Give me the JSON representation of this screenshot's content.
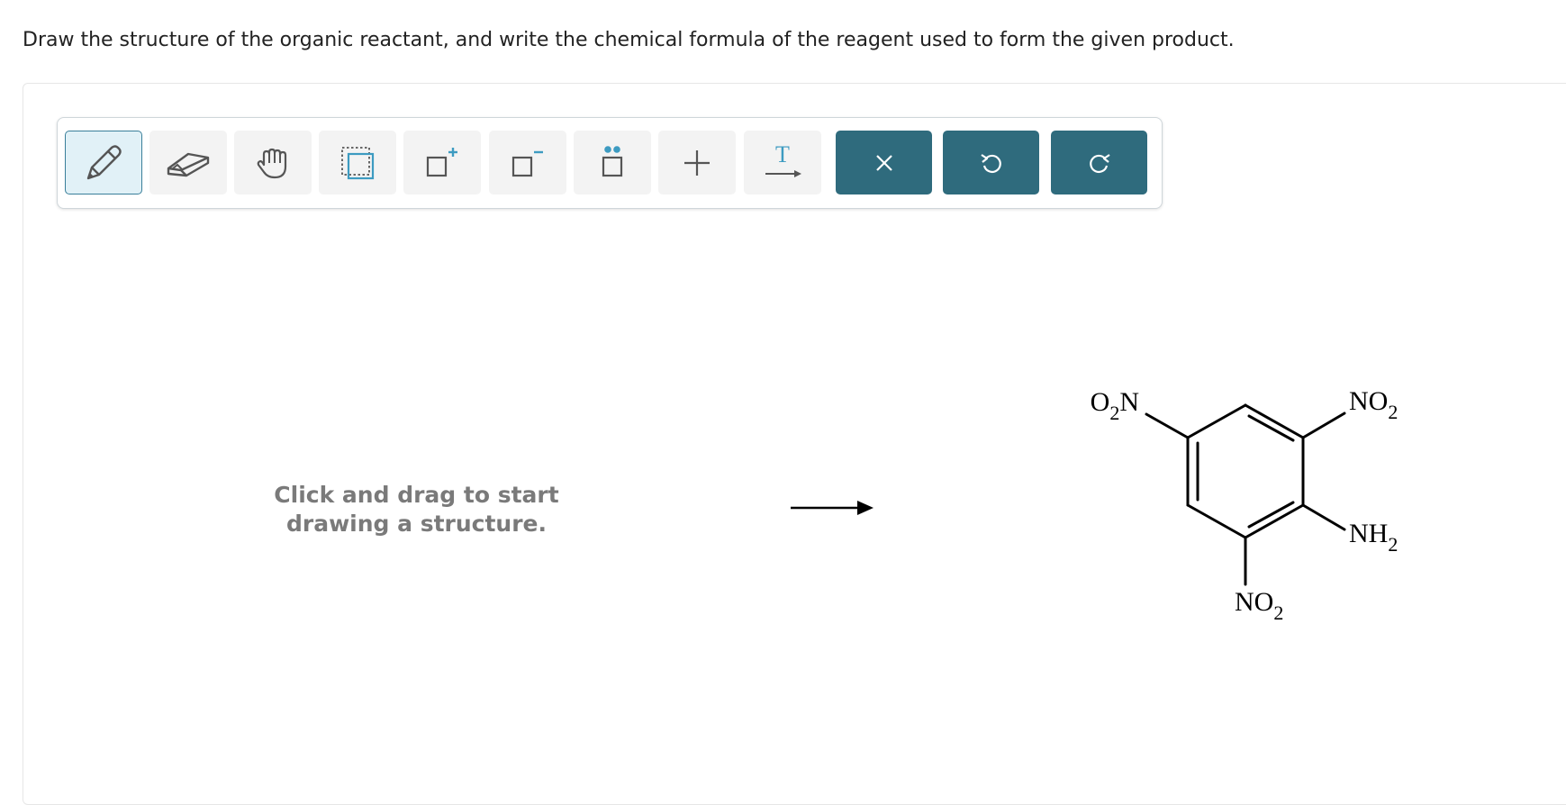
{
  "question": {
    "text": "Draw the structure of the organic reactant, and write the chemical formula of the reagent used to form the given product."
  },
  "toolbar": {
    "tools": [
      {
        "name": "pencil-tool",
        "icon": "pencil-icon",
        "active": true
      },
      {
        "name": "eraser-tool",
        "icon": "eraser-icon",
        "active": false
      },
      {
        "name": "hand-tool",
        "icon": "hand-icon",
        "active": false
      },
      {
        "name": "select-tool",
        "icon": "selection-box-icon",
        "active": false
      },
      {
        "name": "positive-charge-tool",
        "icon": "positive-charge-icon",
        "active": false
      },
      {
        "name": "negative-charge-tool",
        "icon": "negative-charge-icon",
        "active": false
      },
      {
        "name": "lone-pair-tool",
        "icon": "lone-pair-icon",
        "active": false
      },
      {
        "name": "plus-tool",
        "icon": "plus-icon",
        "active": false
      },
      {
        "name": "text-arrow-tool",
        "icon": "text-arrow-icon",
        "active": false
      }
    ],
    "text_tool_label": "T",
    "actions": [
      {
        "name": "clear-button",
        "icon": "close-icon"
      },
      {
        "name": "undo-button",
        "icon": "undo-icon"
      },
      {
        "name": "redo-button",
        "icon": "redo-icon"
      }
    ],
    "colors": {
      "accent": "#2f6b7d",
      "active_bg": "#e1f1f7",
      "tool_bg": "#f3f3f3",
      "icon_blue": "#3d9bc1"
    }
  },
  "canvas": {
    "hint_line1": "Click and drag to start",
    "hint_line2": "drawing a structure."
  },
  "product": {
    "groups": {
      "top_left": {
        "main": "O",
        "sub": "2",
        "tail": "N"
      },
      "top_right": {
        "main": "NO",
        "sub": "2"
      },
      "bottom_right": {
        "main": "NH",
        "sub": "2"
      },
      "bottom": {
        "main": "NO",
        "sub": "2"
      }
    }
  }
}
